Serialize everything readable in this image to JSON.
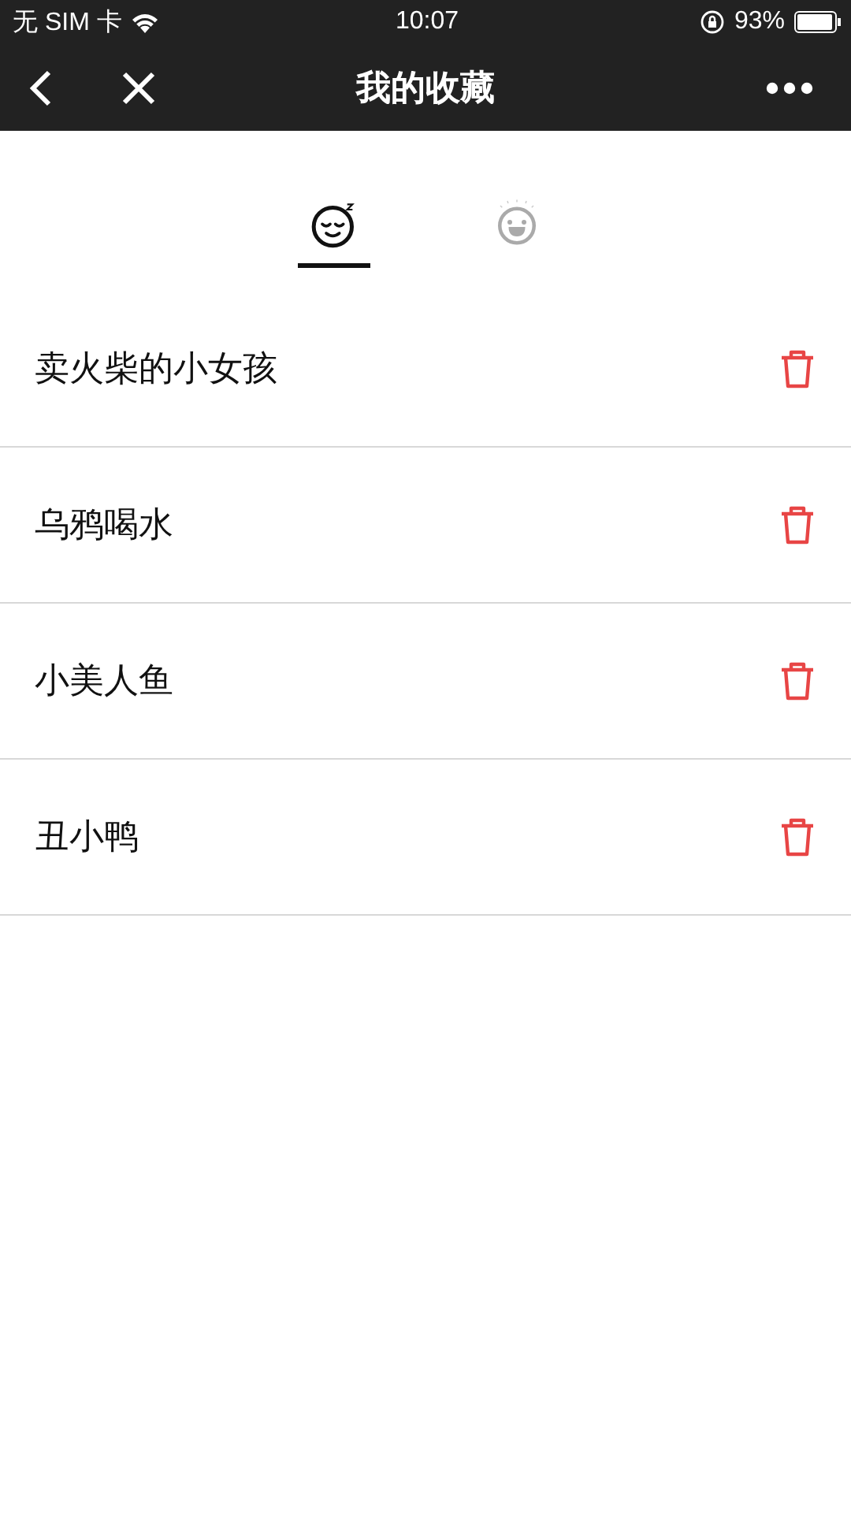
{
  "status_bar": {
    "carrier": "无 SIM 卡",
    "time": "10:07",
    "battery": "93%"
  },
  "nav": {
    "title": "我的收藏"
  },
  "tabs": [
    {
      "kind": "sleepy",
      "selected": true
    },
    {
      "kind": "laughing",
      "selected": false
    }
  ],
  "favorites": [
    {
      "title": "卖火柴的小女孩"
    },
    {
      "title": "乌鸦喝水"
    },
    {
      "title": "小美人鱼"
    },
    {
      "title": "丑小鸭"
    }
  ]
}
